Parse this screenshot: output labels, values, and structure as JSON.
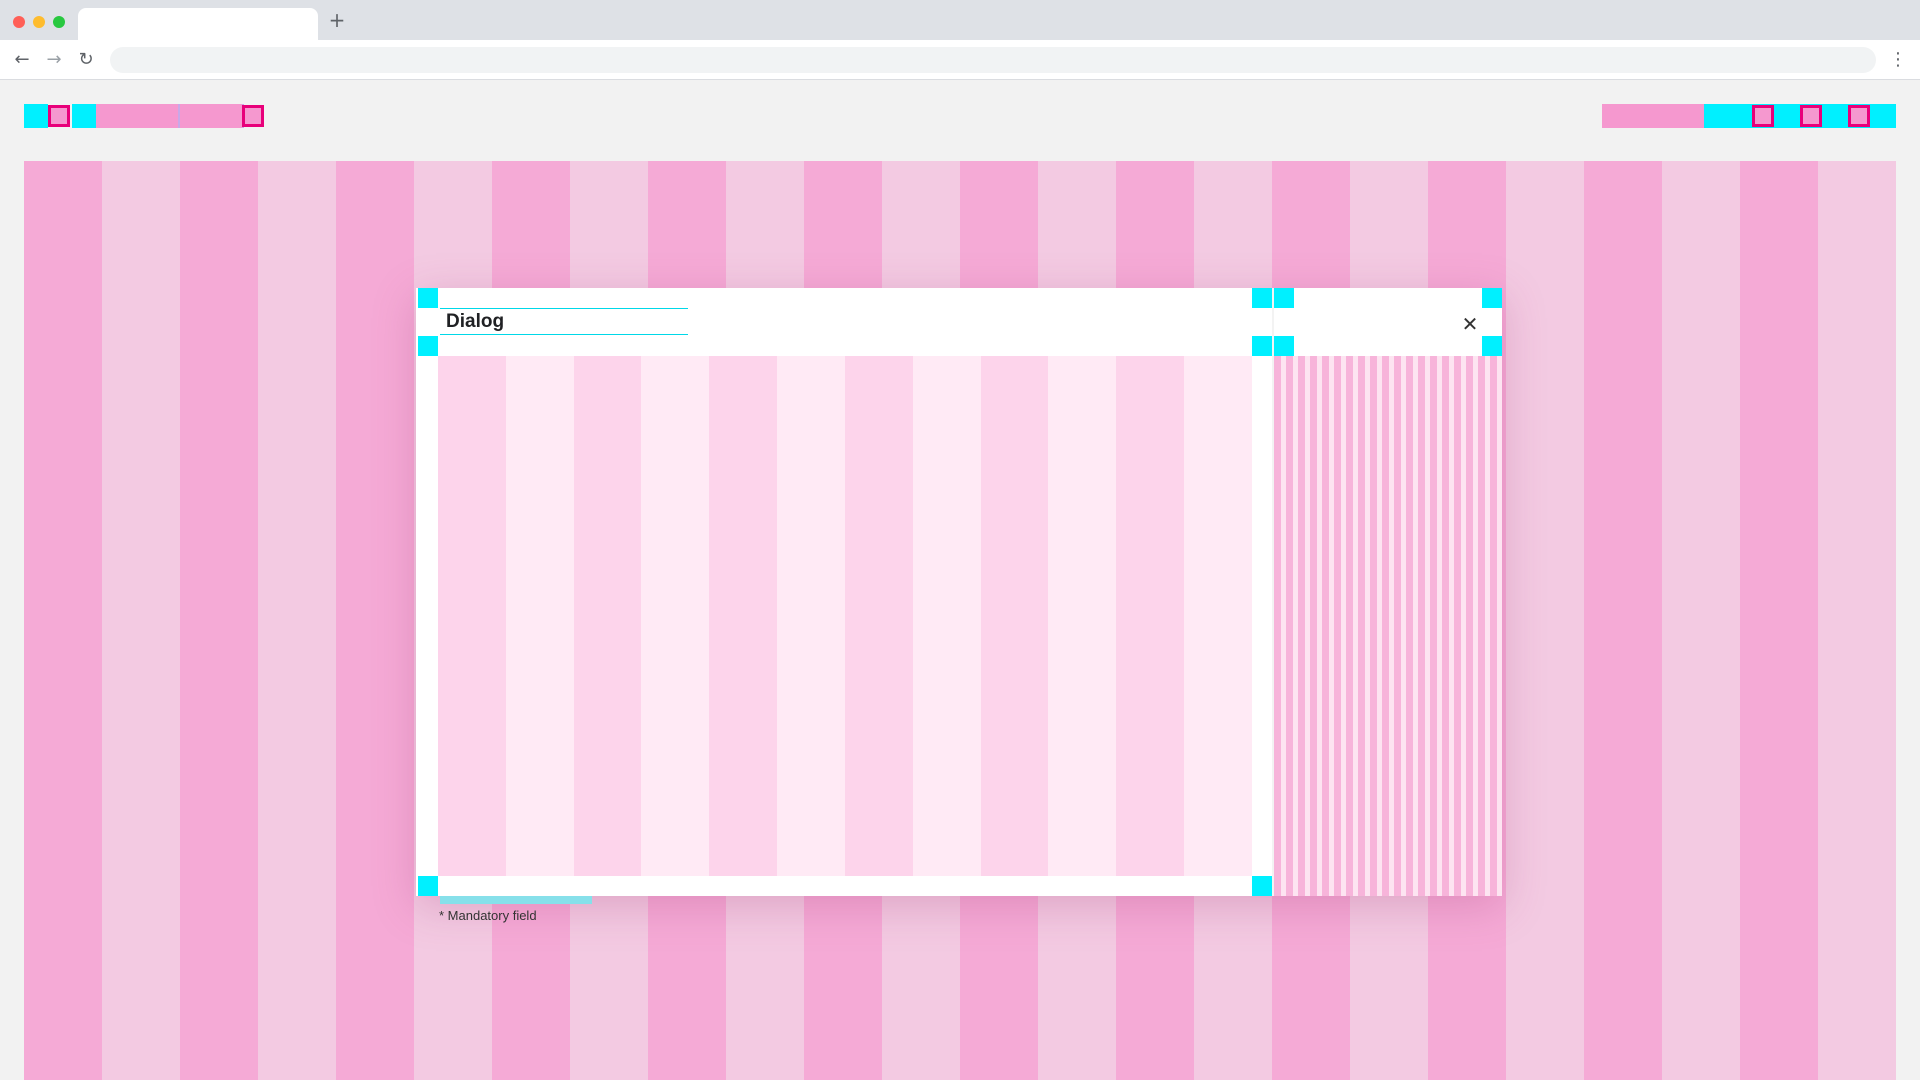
{
  "browser": {
    "tab_title": "",
    "new_tab_glyph": "+",
    "back_glyph": "←",
    "forward_glyph": "→",
    "reload_glyph": "↻",
    "menu_glyph": "⋮",
    "address_value": "",
    "address_placeholder": "",
    "icons": [
      "back-arrow-icon",
      "forward-arrow-icon",
      "reload-icon",
      "kebab-menu-icon",
      "plus-icon"
    ]
  },
  "dialog": {
    "title": "Dialog",
    "close_glyph": "✕",
    "mandatory_note": "* Mandatory field"
  },
  "colors": {
    "spacing_marker": "#00f0ff",
    "grid_column_dark": "#f5aad6",
    "grid_column_light": "#f3cae2",
    "component_border": "#e8007a",
    "component_fill": "#f598cf",
    "dialog_background": "#ffffff"
  },
  "layout_grid": {
    "background_columns": 24,
    "dialog_columns": 12
  }
}
